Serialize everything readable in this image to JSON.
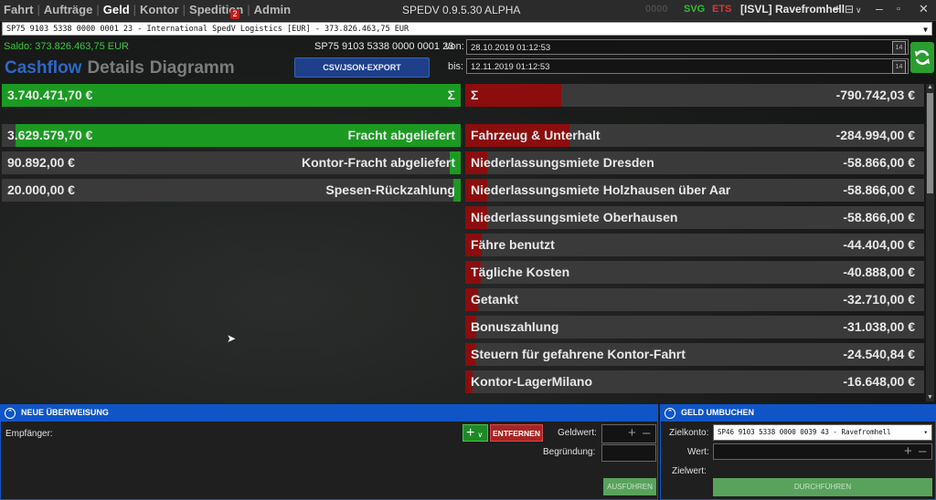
{
  "nav": {
    "items": [
      "Fahrt",
      "Aufträge",
      "Geld",
      "Kontor",
      "Spedition",
      "Admin"
    ],
    "active": "Geld",
    "admin_badge": "2"
  },
  "app_title": "SPEDV 0.9.5.30 ALPHA",
  "indicators": {
    "left": "0000",
    "svg": "SVG",
    "ets": "ETS",
    "user": "[ISVL] Ravefromhell"
  },
  "account_selector": "SP75 9103 5338 0000 0001 23 - International SpedV Logistics [EUR] - 373.826.463,75 EUR",
  "saldo": "Saldo: 373.826.463,75 EUR",
  "iban": "SP75 9103 5338 0000 0001 23",
  "tabs": [
    "Cashflow",
    "Details",
    "Diagramm"
  ],
  "export_label": "CSV/JSON-EXPORT",
  "date_from_label": "von:",
  "date_from": "28.10.2019 01:12:53",
  "date_to_label": "bis:",
  "date_to": "12.11.2019 01:12:53",
  "calendar_icon": "14",
  "income": {
    "sum": {
      "amount": "3.740.471,70 €",
      "label": "Σ",
      "share": 1.0
    },
    "items": [
      {
        "amount": "3.629.579,70 €",
        "label": "Fracht abgeliefert",
        "share": 0.97
      },
      {
        "amount": "90.892,00 €",
        "label": "Kontor-Fracht abgeliefert",
        "share": 0.024
      },
      {
        "amount": "20.000,00 €",
        "label": "Spesen-Rückzahlung",
        "share": 0.005
      }
    ]
  },
  "expenses": {
    "sum": {
      "label": "Σ",
      "amount": "-790.742,03 €",
      "share": 0.21
    },
    "items": [
      {
        "label": "Fahrzeug & Unterhalt",
        "amount": "-284.994,00 €",
        "share": 0.076
      },
      {
        "label": "Niederlassungsmiete Dresden",
        "amount": "-58.866,00 €",
        "share": 0.016
      },
      {
        "label": "Niederlassungsmiete Holzhausen über Aar",
        "amount": "-58.866,00 €",
        "share": 0.016
      },
      {
        "label": "Niederlassungsmiete Oberhausen",
        "amount": "-58.866,00 €",
        "share": 0.016
      },
      {
        "label": "Fähre benutzt",
        "amount": "-44.404,00 €",
        "share": 0.012
      },
      {
        "label": "Tägliche Kosten",
        "amount": "-40.888,00 €",
        "share": 0.011
      },
      {
        "label": "Getankt",
        "amount": "-32.710,00 €",
        "share": 0.009
      },
      {
        "label": "Bonuszahlung",
        "amount": "-31.038,00 €",
        "share": 0.008
      },
      {
        "label": "Steuern für gefahrene Kontor-Fahrt",
        "amount": "-24.540,84 €",
        "share": 0.007
      },
      {
        "label": "Kontor-LagerMilano",
        "amount": "-16.648,00 €",
        "share": 0.005
      }
    ]
  },
  "transfer": {
    "header": "NEUE ÜBERWEISUNG",
    "recipient_label": "Empfänger:",
    "remove_label": "ENTFERNEN",
    "amount_label": "Geldwert:",
    "reason_label": "Begründung:",
    "submit_label": "AUSFÜHREN"
  },
  "rebook": {
    "header": "GELD UMBUCHEN",
    "target_label": "Zielkonto:",
    "target_value": "SP46 9103 5338 0000 0039 43 - Ravefromhell",
    "value_label": "Wert:",
    "target_value_label": "Zielwert:",
    "submit_label": "DURCHFÜHREN"
  },
  "colors": {
    "income": "#1b9a22",
    "expense": "#8b0d0d",
    "accent": "#0f55c8",
    "saldo": "#39c93c"
  }
}
